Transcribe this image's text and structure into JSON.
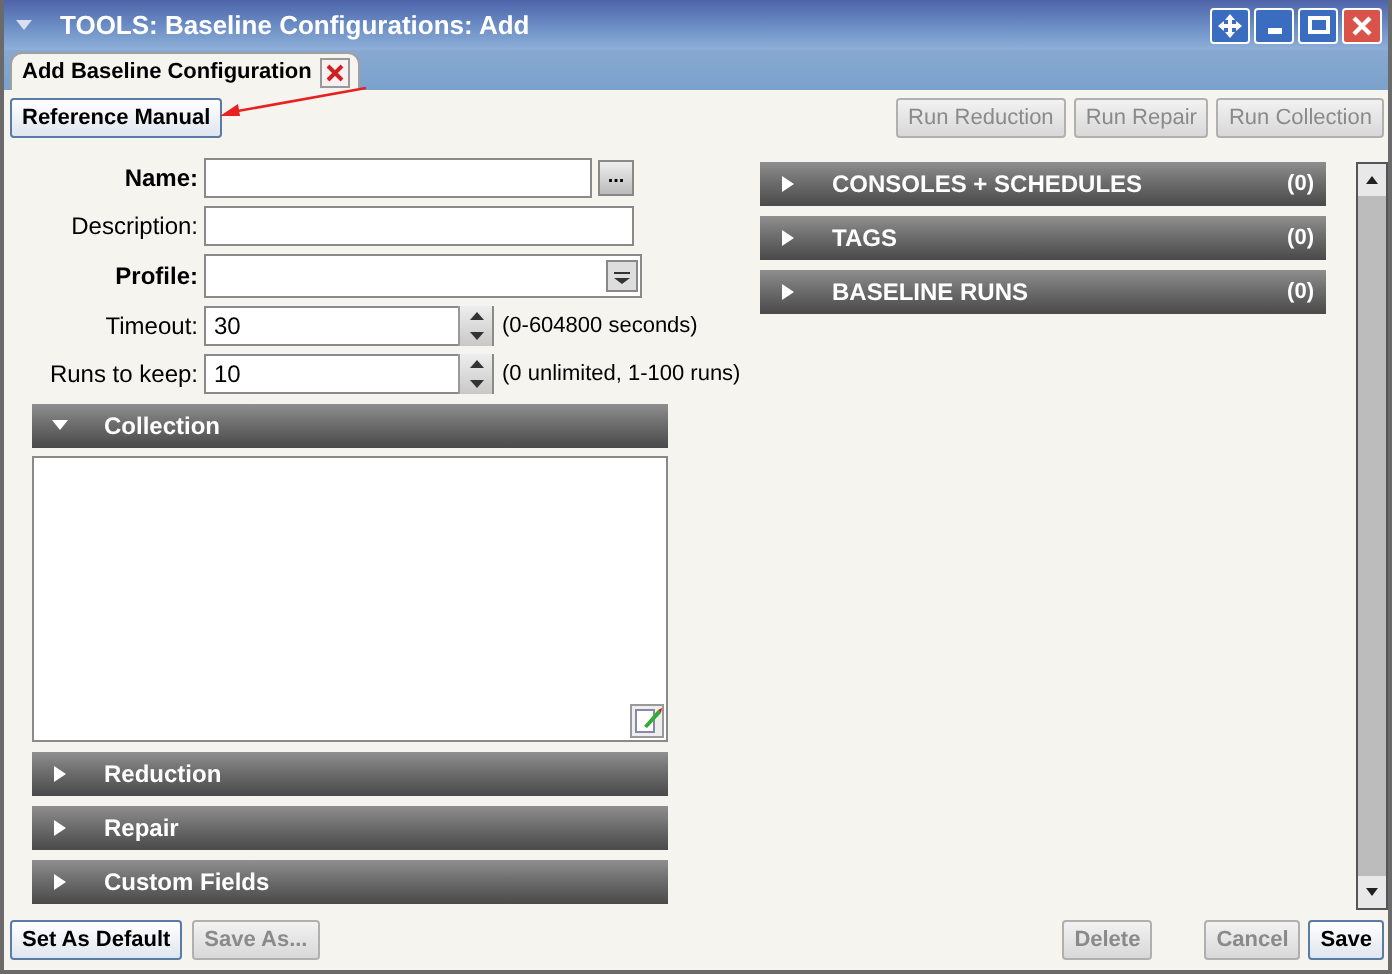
{
  "window": {
    "title": "TOOLS: Baseline Configurations: Add"
  },
  "tabs": [
    {
      "label": "Add Baseline Configuration",
      "selected": true
    }
  ],
  "toolbar": {
    "left": [
      {
        "label": "Reference Manual",
        "disabled": false
      }
    ],
    "right": [
      {
        "label": "Run Reduction",
        "disabled": true
      },
      {
        "label": "Run Repair",
        "disabled": true
      },
      {
        "label": "Run Collection",
        "disabled": true
      }
    ]
  },
  "form": {
    "fields": [
      {
        "kind": "browse",
        "label": "Name:",
        "required": true,
        "button": "..."
      },
      {
        "kind": "text",
        "label": "Description:",
        "required": false
      },
      {
        "kind": "select",
        "label": "Profile:",
        "required": true
      },
      {
        "kind": "spinner",
        "label": "Timeout:",
        "required": false,
        "value": "30",
        "hint": "(0-604800 seconds)"
      },
      {
        "kind": "spinner",
        "label": "Runs to keep:",
        "required": false,
        "value": "10",
        "hint": "(0 unlimited, 1-100 runs)"
      }
    ]
  },
  "left_sections": [
    {
      "title": "Collection",
      "expanded": true
    },
    {
      "title": "Reduction",
      "expanded": false
    },
    {
      "title": "Repair",
      "expanded": false
    },
    {
      "title": "Custom Fields",
      "expanded": false
    }
  ],
  "right_sections": [
    {
      "title": "CONSOLES + SCHEDULES",
      "count": "(0)",
      "expanded": false
    },
    {
      "title": "TAGS",
      "count": "(0)",
      "expanded": false
    },
    {
      "title": "BASELINE RUNS",
      "count": "(0)",
      "expanded": false
    }
  ],
  "footer": {
    "left": [
      {
        "label": "Set As Default",
        "disabled": false
      },
      {
        "label": "Save As...",
        "disabled": true
      }
    ],
    "right": [
      {
        "label": "Delete",
        "disabled": true
      },
      {
        "label": "Cancel",
        "disabled": true
      },
      {
        "label": "Save",
        "disabled": false
      }
    ]
  }
}
